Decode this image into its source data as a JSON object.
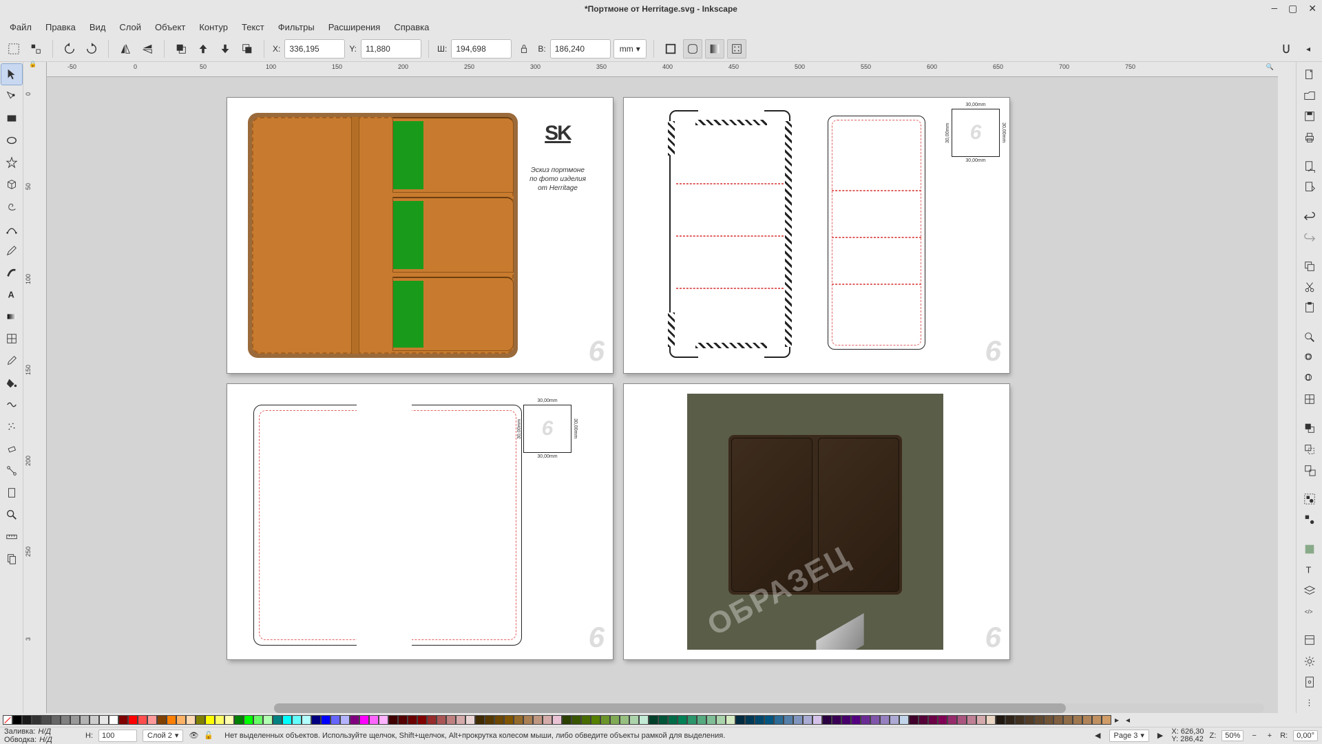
{
  "window": {
    "title": "*Портмоне от Herritage.svg - Inkscape"
  },
  "menu": {
    "file": "Файл",
    "edit": "Правка",
    "view": "Вид",
    "layer": "Слой",
    "object": "Объект",
    "path": "Контур",
    "text": "Текст",
    "filters": "Фильтры",
    "extensions": "Расширения",
    "help": "Справка"
  },
  "tcb": {
    "x_label": "X:",
    "x_value": "336,195",
    "y_label": "Y:",
    "y_value": "11,880",
    "w_label": "Ш:",
    "w_value": "194,698",
    "h_label": "В:",
    "h_value": "186,240",
    "unit": "mm"
  },
  "ruler_h": [
    "-50",
    "0",
    "50",
    "100",
    "150",
    "200",
    "250",
    "300",
    "350",
    "400",
    "450",
    "500",
    "550",
    "600",
    "650",
    "700",
    "750"
  ],
  "ruler_v": [
    "0",
    "50",
    "100",
    "150",
    "200",
    "250",
    "3"
  ],
  "page1": {
    "logo": "SK",
    "desc_l1": "Эскиз портмоне",
    "desc_l2": "по фото изделия",
    "desc_l3": "от Herritage",
    "watermark": "6"
  },
  "page2": {
    "dim": "30,00mm",
    "watermark": "6"
  },
  "page3": {
    "dim": "30,00mm",
    "watermark": "6"
  },
  "page4": {
    "sample": "ОБРАЗЕЦ",
    "watermark": "6"
  },
  "status": {
    "fill_label": "Заливка:",
    "fill_value": "Н/Д",
    "stroke_label": "Обводка:",
    "stroke_value": "Н/Д",
    "opacity_label": "Н:",
    "opacity_value": "100",
    "layer": "Слой 2",
    "hint": "Нет выделенных объектов. Используйте щелчок, Shift+щелчок, Alt+прокрутка колесом мыши, либо обведите объекты рамкой для выделения.",
    "page_label": "Page 3",
    "cursor_x_label": "X:",
    "cursor_x": "626,30",
    "cursor_y_label": "Y:",
    "cursor_y": "286,42",
    "z_label": "Z:",
    "zoom": "50%",
    "r_label": "R:",
    "rotation": "0,00°"
  }
}
